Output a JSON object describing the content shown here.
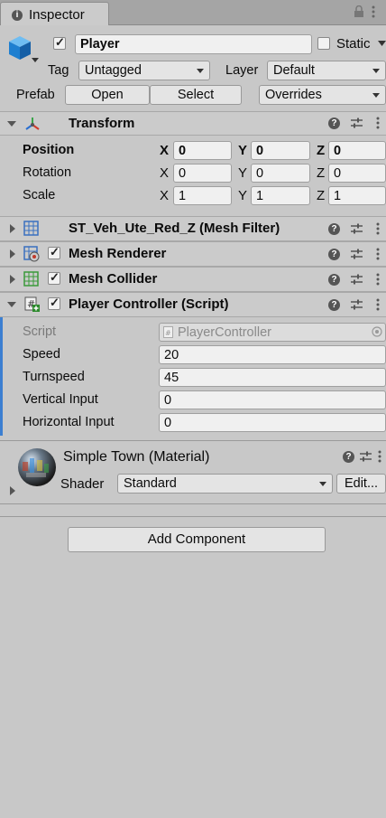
{
  "window": {
    "tab_label": "Inspector",
    "tab_icon": "info-icon"
  },
  "gameobject": {
    "active": true,
    "name": "Player",
    "static_label": "Static",
    "static_checked": false,
    "tag_label": "Tag",
    "tag_value": "Untagged",
    "layer_label": "Layer",
    "layer_value": "Default",
    "prefab_label": "Prefab",
    "open_label": "Open",
    "select_label": "Select",
    "overrides_label": "Overrides"
  },
  "transform": {
    "title": "Transform",
    "position_label": "Position",
    "rotation_label": "Rotation",
    "scale_label": "Scale",
    "axis_x": "X",
    "axis_y": "Y",
    "axis_z": "Z",
    "position": {
      "x": "0",
      "y": "0",
      "z": "0"
    },
    "rotation": {
      "x": "0",
      "y": "0",
      "z": "0"
    },
    "scale": {
      "x": "1",
      "y": "1",
      "z": "1"
    }
  },
  "components": {
    "mesh_filter": {
      "title": "ST_Veh_Ute_Red_Z (Mesh Filter)"
    },
    "mesh_renderer": {
      "title": "Mesh Renderer",
      "enabled": true
    },
    "mesh_collider": {
      "title": "Mesh Collider",
      "enabled": true
    },
    "player_controller": {
      "title": "Player Controller (Script)",
      "enabled": true,
      "script_label": "Script",
      "script_value": "PlayerController",
      "speed_label": "Speed",
      "speed_value": "20",
      "turnspeed_label": "Turnspeed",
      "turnspeed_value": "45",
      "vertical_label": "Vertical Input",
      "vertical_value": "0",
      "horizontal_label": "Horizontal Input",
      "horizontal_value": "0"
    }
  },
  "material": {
    "title": "Simple Town (Material)",
    "shader_label": "Shader",
    "shader_value": "Standard",
    "edit_label": "Edit..."
  },
  "add_component_label": "Add Component",
  "colors": {
    "panel_bg": "#c8c8c8",
    "header_bg": "#cbcbcb",
    "field_bg": "#f0f0f0",
    "accent_blue": "#1e8fd6",
    "script_bar": "#3c7fd1"
  }
}
